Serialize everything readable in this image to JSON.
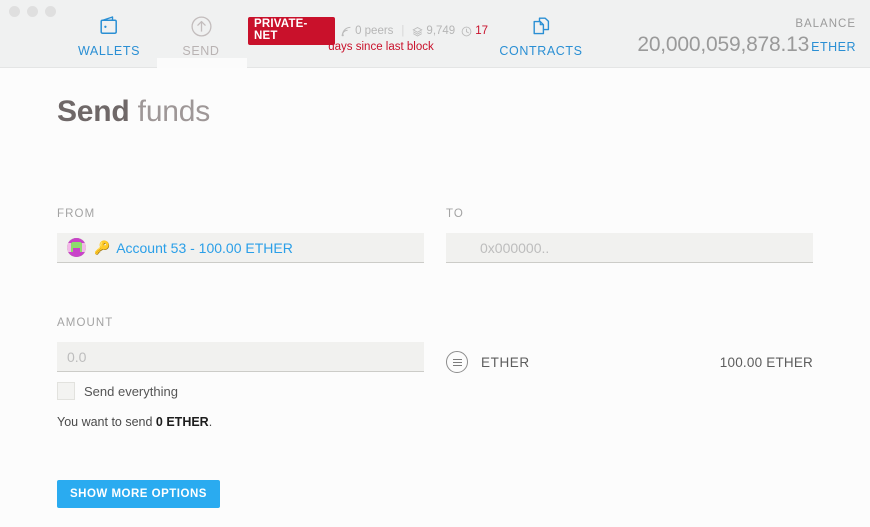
{
  "window": {
    "traffic_lights": [
      "close",
      "minimize",
      "maximize"
    ]
  },
  "header": {
    "tabs": [
      {
        "id": "wallets",
        "label": "WALLETS",
        "icon": "wallet-icon",
        "active": false,
        "color": "#2a8fd4"
      },
      {
        "id": "send",
        "label": "SEND",
        "icon": "send-arrow-icon",
        "active": true,
        "color": "#b9b3b3"
      },
      {
        "id": "contracts",
        "label": "CONTRACTS",
        "icon": "documents-icon",
        "active": false,
        "color": "#2a8fd4"
      }
    ],
    "status": {
      "network_badge": "PRIVATE-NET",
      "peers": "0 peers",
      "peers_icon": "signal-icon",
      "blocks": "9,749",
      "blocks_icon": "block-icon",
      "separator": "|",
      "last_block_days": "17",
      "last_block_icon": "clock-icon",
      "last_block_caption": "days since last block",
      "badge_color": "#c9112b",
      "alert_color": "#c9112b"
    },
    "balance": {
      "label": "BALANCE",
      "value": "20,000,059,878.13",
      "unit": "ETHER",
      "unit_color": "#2a8fd4"
    }
  },
  "main": {
    "title_strong": "Send",
    "title_light": " funds",
    "from": {
      "label": "FROM",
      "identicon": "account-identicon",
      "key_icon": "🔑",
      "account_text": "Account 53 - 100.00 ETHER"
    },
    "to": {
      "label": "TO",
      "placeholder": "0x000000..",
      "value": ""
    },
    "amount": {
      "label": "AMOUNT",
      "placeholder": "0.0",
      "value": "",
      "send_everything_label": "Send everything",
      "send_everything_checked": false,
      "summary_prefix": "You want to send ",
      "summary_amount": "0 ETHER",
      "summary_suffix": "."
    },
    "currency": {
      "icon": "list-circle-icon",
      "name": "ETHER",
      "amount": "100.00 ETHER"
    },
    "show_more_button": "SHOW MORE OPTIONS",
    "accent_color": "#2aabf0"
  }
}
